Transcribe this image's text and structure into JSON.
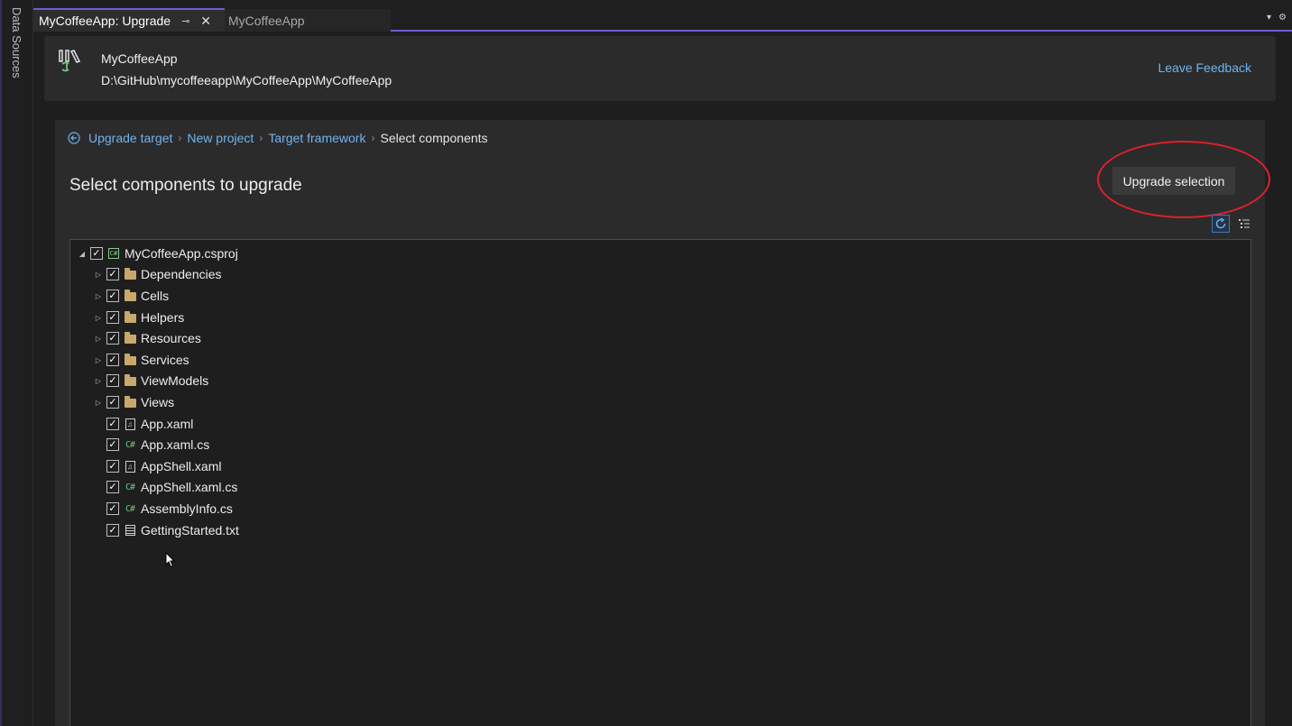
{
  "side_panel": {
    "label": "Data Sources"
  },
  "tabs": [
    {
      "label": "MyCoffeeApp: Upgrade",
      "active": true
    },
    {
      "label": "MyCoffeeApp",
      "active": false
    }
  ],
  "header": {
    "project_name": "MyCoffeeApp",
    "project_path": "D:\\GitHub\\mycoffeeapp\\MyCoffeeApp\\MyCoffeeApp",
    "feedback_label": "Leave Feedback"
  },
  "breadcrumb": {
    "items": [
      "Upgrade target",
      "New project",
      "Target framework"
    ],
    "current": "Select components"
  },
  "main": {
    "title": "Select components to upgrade",
    "upgrade_button": "Upgrade selection"
  },
  "tree": {
    "root": {
      "label": "MyCoffeeApp.csproj",
      "checked": true,
      "expanded": true
    },
    "children": [
      {
        "label": "Dependencies",
        "type": "folder",
        "checked": true
      },
      {
        "label": "Cells",
        "type": "folder",
        "checked": true
      },
      {
        "label": "Helpers",
        "type": "folder",
        "checked": true
      },
      {
        "label": "Resources",
        "type": "folder",
        "checked": true
      },
      {
        "label": "Services",
        "type": "folder",
        "checked": true
      },
      {
        "label": "ViewModels",
        "type": "folder",
        "checked": true
      },
      {
        "label": "Views",
        "type": "folder",
        "checked": true
      },
      {
        "label": "App.xaml",
        "type": "xaml",
        "checked": true
      },
      {
        "label": "App.xaml.cs",
        "type": "cs",
        "checked": true
      },
      {
        "label": "AppShell.xaml",
        "type": "xaml",
        "checked": true
      },
      {
        "label": "AppShell.xaml.cs",
        "type": "cs",
        "checked": true
      },
      {
        "label": "AssemblyInfo.cs",
        "type": "cs",
        "checked": true
      },
      {
        "label": "GettingStarted.txt",
        "type": "txt",
        "checked": true
      }
    ]
  },
  "colors": {
    "accent": "#6b5fd3",
    "link": "#6fb3f0",
    "highlight_ring": "#e0202a"
  }
}
